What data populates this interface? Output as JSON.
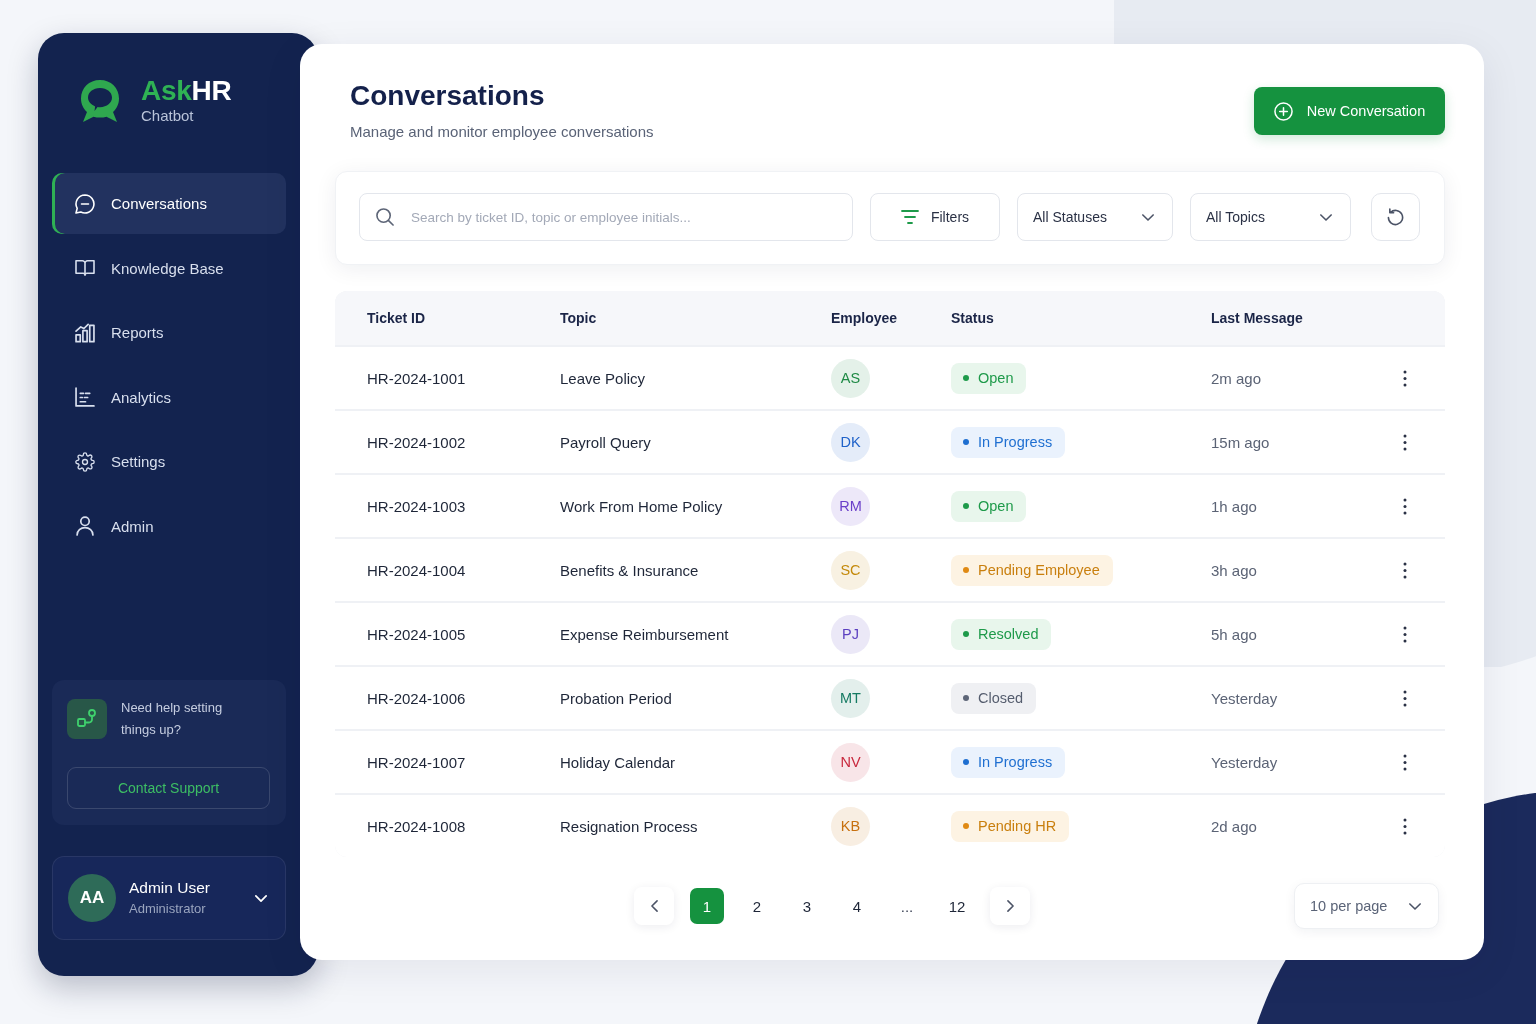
{
  "sidebar": {
    "logo": {
      "name_accent": "Ask",
      "name_rest": "HR",
      "tagline": "Chatbot"
    },
    "nav_items": [
      {
        "label": "Conversations",
        "selected": true
      },
      {
        "label": "Knowledge Base",
        "selected": false
      },
      {
        "label": "Reports",
        "selected": false
      },
      {
        "label": "Analytics",
        "selected": false
      },
      {
        "label": "Settings",
        "selected": false
      },
      {
        "label": "Admin",
        "selected": false
      }
    ],
    "help_card": {
      "text": "Need help setting things up?",
      "button": "Contact Support"
    },
    "user": {
      "initials": "AA",
      "name": "Admin User",
      "role": "Administrator"
    }
  },
  "header": {
    "title": "Conversations",
    "subtitle": "Manage and monitor employee conversations",
    "new_button": "New Conversation"
  },
  "filters": {
    "search": {
      "placeholder": "Search by ticket ID, topic or employee initials..."
    },
    "filters_button": "Filters",
    "status_filter": "All Statuses",
    "topic_filter": "All Topics"
  },
  "table": {
    "columns": [
      "Ticket ID",
      "Topic",
      "Employee",
      "Status",
      "Last Message"
    ],
    "rows": [
      {
        "ticket_id": "HR-2024-1001",
        "topic": "Leave Policy",
        "employee": {
          "initials": "AS",
          "color": "#1f8a45"
        },
        "status": {
          "label": "Open",
          "kind": "open"
        },
        "last_message": "2m ago"
      },
      {
        "ticket_id": "HR-2024-1002",
        "topic": "Payroll Query",
        "employee": {
          "initials": "DK",
          "color": "#1f62c9"
        },
        "status": {
          "label": "In Progress",
          "kind": "in_progress"
        },
        "last_message": "15m ago"
      },
      {
        "ticket_id": "HR-2024-1003",
        "topic": "Work From Home Policy",
        "employee": {
          "initials": "RM",
          "color": "#6a3fc9"
        },
        "status": {
          "label": "Open",
          "kind": "open"
        },
        "last_message": "1h ago"
      },
      {
        "ticket_id": "HR-2024-1004",
        "topic": "Benefits & Insurance",
        "employee": {
          "initials": "SC",
          "color": "#c48a0c"
        },
        "status": {
          "label": "Pending Employee",
          "kind": "pending"
        },
        "last_message": "3h ago"
      },
      {
        "ticket_id": "HR-2024-1005",
        "topic": "Expense Reimbursement",
        "employee": {
          "initials": "PJ",
          "color": "#5b3fc0"
        },
        "status": {
          "label": "Resolved",
          "kind": "resolved"
        },
        "last_message": "5h ago"
      },
      {
        "ticket_id": "HR-2024-1006",
        "topic": "Probation Period",
        "employee": {
          "initials": "MT",
          "color": "#157a62"
        },
        "status": {
          "label": "Closed",
          "kind": "closed"
        },
        "last_message": "Yesterday"
      },
      {
        "ticket_id": "HR-2024-1007",
        "topic": "Holiday Calendar",
        "employee": {
          "initials": "NV",
          "color": "#c8283d"
        },
        "status": {
          "label": "In Progress",
          "kind": "in_progress"
        },
        "last_message": "Yesterday"
      },
      {
        "ticket_id": "HR-2024-1008",
        "topic": "Resignation Process",
        "employee": {
          "initials": "KB",
          "color": "#c7700f"
        },
        "status": {
          "label": "Pending HR",
          "kind": "pending"
        },
        "last_message": "2d ago"
      }
    ]
  },
  "pagination": {
    "pages": [
      {
        "label": "1",
        "kind": "page",
        "selected": true
      },
      {
        "label": "2",
        "kind": "page",
        "selected": false
      },
      {
        "label": "3",
        "kind": "page",
        "selected": false
      },
      {
        "label": "4",
        "kind": "page",
        "selected": false
      },
      {
        "label": "...",
        "kind": "ellipsis",
        "selected": false
      },
      {
        "label": "12",
        "kind": "page",
        "selected": false
      }
    ],
    "per_page": "10 per page"
  }
}
